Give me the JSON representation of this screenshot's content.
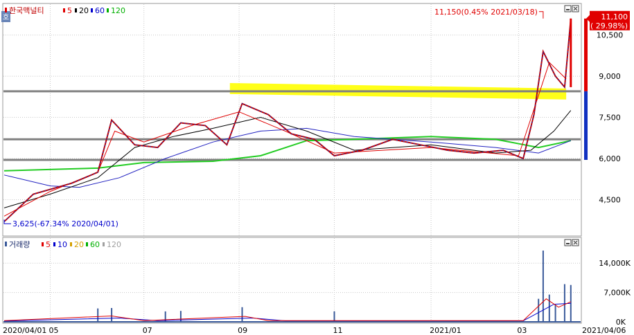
{
  "chart_data": [
    {
      "type": "candlestick",
      "stock_name": "한국맥널티",
      "ma_legend": [
        {
          "label": "5",
          "color": "#e00000"
        },
        {
          "label": "20",
          "color": "#000000"
        },
        {
          "label": "60",
          "color": "#0000cc"
        },
        {
          "label": "120",
          "color": "#00b000"
        }
      ],
      "y_ticks": [
        4500,
        6000,
        7500,
        9000,
        10500
      ],
      "y_tick_labels": [
        "4,500",
        "6,000",
        "7,500",
        "9,000",
        "10,500"
      ],
      "ylim": [
        3200,
        11600
      ],
      "x_date_range": [
        "2020/04/01",
        "2021/04/06"
      ],
      "x_tick_labels": [
        {
          "label": "2020/04/01",
          "date": "2020-04-01"
        },
        {
          "label": "05",
          "date": "2020-05-01"
        },
        {
          "label": "07",
          "date": "2020-07-01"
        },
        {
          "label": "09",
          "date": "2020-09-01"
        },
        {
          "label": "11",
          "date": "2020-11-02"
        },
        {
          "label": "2021/01",
          "date": "2021-01-04"
        },
        {
          "label": "03",
          "date": "2021-03-02"
        },
        {
          "label": "2021/04/06",
          "date": "2021-04-06"
        }
      ],
      "horizontal_lines": [
        8450,
        6700,
        5950
      ],
      "highlight_band": {
        "from": "2020-08-26",
        "to": "2021-04-02",
        "start_low": 8350,
        "start_high": 8750,
        "end_low": 8150,
        "end_high": 8550,
        "color": "#ffff00"
      },
      "annotations": [
        {
          "text": "11,150(0.45% 2021/03/18)",
          "value": 11150,
          "date": "2021-03-18",
          "color": "#e00000"
        },
        {
          "text": "3,625(-67.34% 2020/04/01)",
          "value": 3625,
          "date": "2020-04-01",
          "color": "#0000cc"
        }
      ],
      "last_price": {
        "text": "11,100",
        "change": "( 29.98%)",
        "value": 11100
      },
      "series": [
        {
          "name": "price",
          "points": [
            {
              "date": "2020-04-01",
              "value": 3700
            },
            {
              "date": "2020-04-20",
              "value": 4700
            },
            {
              "date": "2020-05-15",
              "value": 5100
            },
            {
              "date": "2020-06-01",
              "value": 5500
            },
            {
              "date": "2020-06-10",
              "value": 7400
            },
            {
              "date": "2020-06-25",
              "value": 6500
            },
            {
              "date": "2020-07-10",
              "value": 6400
            },
            {
              "date": "2020-07-25",
              "value": 7300
            },
            {
              "date": "2020-08-10",
              "value": 7200
            },
            {
              "date": "2020-08-24",
              "value": 6500
            },
            {
              "date": "2020-09-03",
              "value": 8000
            },
            {
              "date": "2020-09-20",
              "value": 7600
            },
            {
              "date": "2020-10-05",
              "value": 6900
            },
            {
              "date": "2020-10-20",
              "value": 6700
            },
            {
              "date": "2020-11-02",
              "value": 6100
            },
            {
              "date": "2020-11-20",
              "value": 6300
            },
            {
              "date": "2020-12-10",
              "value": 6700
            },
            {
              "date": "2020-12-28",
              "value": 6500
            },
            {
              "date": "2021-01-15",
              "value": 6300
            },
            {
              "date": "2021-02-01",
              "value": 6200
            },
            {
              "date": "2021-02-20",
              "value": 6300
            },
            {
              "date": "2021-03-05",
              "value": 6000
            },
            {
              "date": "2021-03-12",
              "value": 7600
            },
            {
              "date": "2021-03-18",
              "value": 9900
            },
            {
              "date": "2021-03-26",
              "value": 9000
            },
            {
              "date": "2021-04-01",
              "value": 8600
            },
            {
              "date": "2021-04-05",
              "value": 11100
            }
          ]
        },
        {
          "name": "5",
          "points": [
            {
              "date": "2020-04-01",
              "value": 3900
            },
            {
              "date": "2020-05-01",
              "value": 4800
            },
            {
              "date": "2020-06-01",
              "value": 5500
            },
            {
              "date": "2020-06-12",
              "value": 7000
            },
            {
              "date": "2020-07-01",
              "value": 6600
            },
            {
              "date": "2020-08-01",
              "value": 7200
            },
            {
              "date": "2020-09-01",
              "value": 7700
            },
            {
              "date": "2020-10-01",
              "value": 7000
            },
            {
              "date": "2020-11-02",
              "value": 6200
            },
            {
              "date": "2021-01-04",
              "value": 6400
            },
            {
              "date": "2021-03-02",
              "value": 6100
            },
            {
              "date": "2021-03-15",
              "value": 8300
            },
            {
              "date": "2021-03-22",
              "value": 9500
            },
            {
              "date": "2021-04-02",
              "value": 8900
            }
          ]
        },
        {
          "name": "20",
          "points": [
            {
              "date": "2020-04-01",
              "value": 4200
            },
            {
              "date": "2020-05-01",
              "value": 4700
            },
            {
              "date": "2020-06-01",
              "value": 5300
            },
            {
              "date": "2020-06-25",
              "value": 6400
            },
            {
              "date": "2020-07-20",
              "value": 6800
            },
            {
              "date": "2020-08-15",
              "value": 7100
            },
            {
              "date": "2020-09-15",
              "value": 7500
            },
            {
              "date": "2020-10-15",
              "value": 7000
            },
            {
              "date": "2020-11-15",
              "value": 6300
            },
            {
              "date": "2021-01-04",
              "value": 6500
            },
            {
              "date": "2021-02-15",
              "value": 6200
            },
            {
              "date": "2021-03-10",
              "value": 6300
            },
            {
              "date": "2021-03-25",
              "value": 7000
            },
            {
              "date": "2021-04-05",
              "value": 7750
            }
          ]
        },
        {
          "name": "60",
          "points": [
            {
              "date": "2020-04-01",
              "value": 5400
            },
            {
              "date": "2020-05-01",
              "value": 5000
            },
            {
              "date": "2020-05-20",
              "value": 4950
            },
            {
              "date": "2020-06-15",
              "value": 5300
            },
            {
              "date": "2020-07-15",
              "value": 6000
            },
            {
              "date": "2020-08-15",
              "value": 6600
            },
            {
              "date": "2020-09-15",
              "value": 7000
            },
            {
              "date": "2020-10-15",
              "value": 7100
            },
            {
              "date": "2020-11-15",
              "value": 6800
            },
            {
              "date": "2021-01-04",
              "value": 6600
            },
            {
              "date": "2021-02-15",
              "value": 6400
            },
            {
              "date": "2021-03-15",
              "value": 6200
            },
            {
              "date": "2021-04-05",
              "value": 6650
            }
          ]
        },
        {
          "name": "120",
          "points": [
            {
              "date": "2020-04-01",
              "value": 5550
            },
            {
              "date": "2020-06-01",
              "value": 5650
            },
            {
              "date": "2020-07-01",
              "value": 5850
            },
            {
              "date": "2020-08-15",
              "value": 5900
            },
            {
              "date": "2020-09-15",
              "value": 6100
            },
            {
              "date": "2020-10-15",
              "value": 6650
            },
            {
              "date": "2020-11-15",
              "value": 6700
            },
            {
              "date": "2021-01-04",
              "value": 6800
            },
            {
              "date": "2021-02-15",
              "value": 6700
            },
            {
              "date": "2021-03-15",
              "value": 6400
            },
            {
              "date": "2021-04-05",
              "value": 6650
            }
          ]
        }
      ]
    },
    {
      "type": "bar",
      "title": "거래량",
      "ma_legend": [
        {
          "label": "5",
          "color": "#e00000"
        },
        {
          "label": "10",
          "color": "#0000cc"
        },
        {
          "label": "20",
          "color": "#d4a000"
        },
        {
          "label": "60",
          "color": "#00b000"
        },
        {
          "label": "120",
          "color": "#a0a0a0"
        }
      ],
      "y_ticks": [
        0,
        7000,
        14000
      ],
      "y_tick_labels": [
        "0K",
        "7,000K",
        "14,000K"
      ],
      "ylim": [
        0,
        17000
      ],
      "bar_color": "#3a5a9a",
      "x": [
        "2020-06-01",
        "2020-06-10",
        "2020-07-15",
        "2020-07-25",
        "2020-09-03",
        "2020-11-02",
        "2021-03-15",
        "2021-03-18",
        "2021-03-22",
        "2021-03-26",
        "2021-04-01",
        "2021-04-05"
      ],
      "values": [
        3200,
        3300,
        2500,
        2600,
        3500,
        2500,
        5500,
        17000,
        6500,
        4000,
        9000,
        8800
      ],
      "series": [
        {
          "name": "5",
          "points": [
            {
              "date": "2020-04-01",
              "value": 300
            },
            {
              "date": "2020-06-10",
              "value": 1400
            },
            {
              "date": "2020-07-01",
              "value": 300
            },
            {
              "date": "2020-09-05",
              "value": 1300
            },
            {
              "date": "2020-09-20",
              "value": 300
            },
            {
              "date": "2021-03-05",
              "value": 300
            },
            {
              "date": "2021-03-20",
              "value": 5500
            },
            {
              "date": "2021-03-28",
              "value": 3500
            },
            {
              "date": "2021-04-05",
              "value": 4800
            }
          ]
        },
        {
          "name": "10",
          "points": [
            {
              "date": "2020-04-01",
              "value": 200
            },
            {
              "date": "2020-06-15",
              "value": 900
            },
            {
              "date": "2020-07-10",
              "value": 300
            },
            {
              "date": "2020-09-10",
              "value": 900
            },
            {
              "date": "2020-10-01",
              "value": 250
            },
            {
              "date": "2021-03-05",
              "value": 250
            },
            {
              "date": "2021-03-25",
              "value": 4200
            },
            {
              "date": "2021-04-05",
              "value": 4400
            }
          ]
        }
      ]
    }
  ]
}
